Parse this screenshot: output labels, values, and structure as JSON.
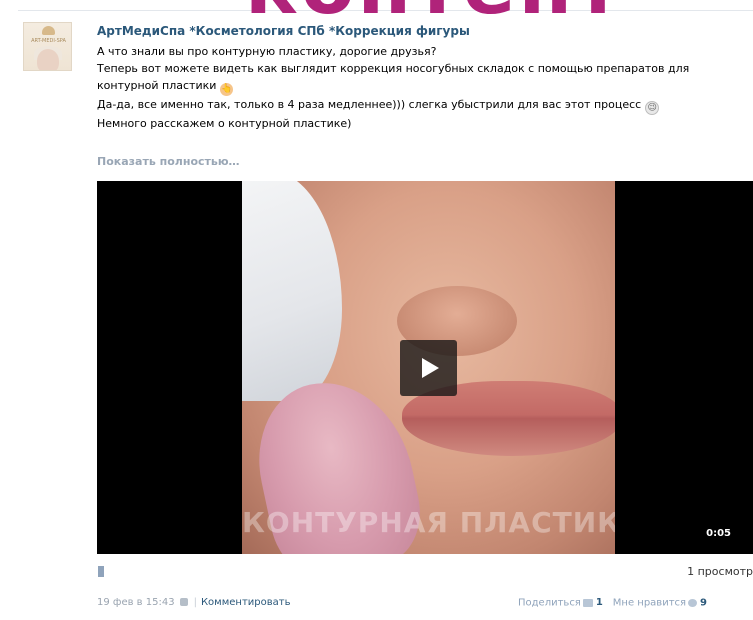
{
  "overlay": {
    "word": "контент"
  },
  "post": {
    "author": "АртМедиСпа *Косметология СПб *Коррекция фигуры",
    "avatar_brand": "ART-MEDI-SPA",
    "lines": [
      "А что знали вы про контурную пластику, дорогие друзья?",
      "Теперь вот можете видеть как выглядит коррекция носогубных складок с помощью препаратов для",
      "контурной пластики",
      "Да-да, все именно так, только в 4 раза медленнее))) слегка убыстрили для вас этот процесс",
      "Немного расскажем о контурной пластике)"
    ],
    "show_more": "Показать полностью…",
    "emoji_hand": "👆",
    "emoji_wink": "😉"
  },
  "video": {
    "watermark": "КОНТУРНАЯ ПЛАСТИКА",
    "duration": "0:05",
    "views": "1 просмотр"
  },
  "footer": {
    "date": "19 фев в 15:43",
    "separator": "|",
    "comment": "Комментировать",
    "share_label": "Поделиться",
    "share_count": "1",
    "like_label": "Мне нравится",
    "like_count": "9"
  },
  "colors": {
    "overlay": "#b0237a",
    "link": "#2b587a",
    "muted": "#99a6b5"
  },
  "icons": {
    "lock": "lock-icon",
    "share": "megaphone-icon",
    "like": "heart-icon",
    "audio": "audio-bar-icon",
    "play": "play-icon"
  }
}
